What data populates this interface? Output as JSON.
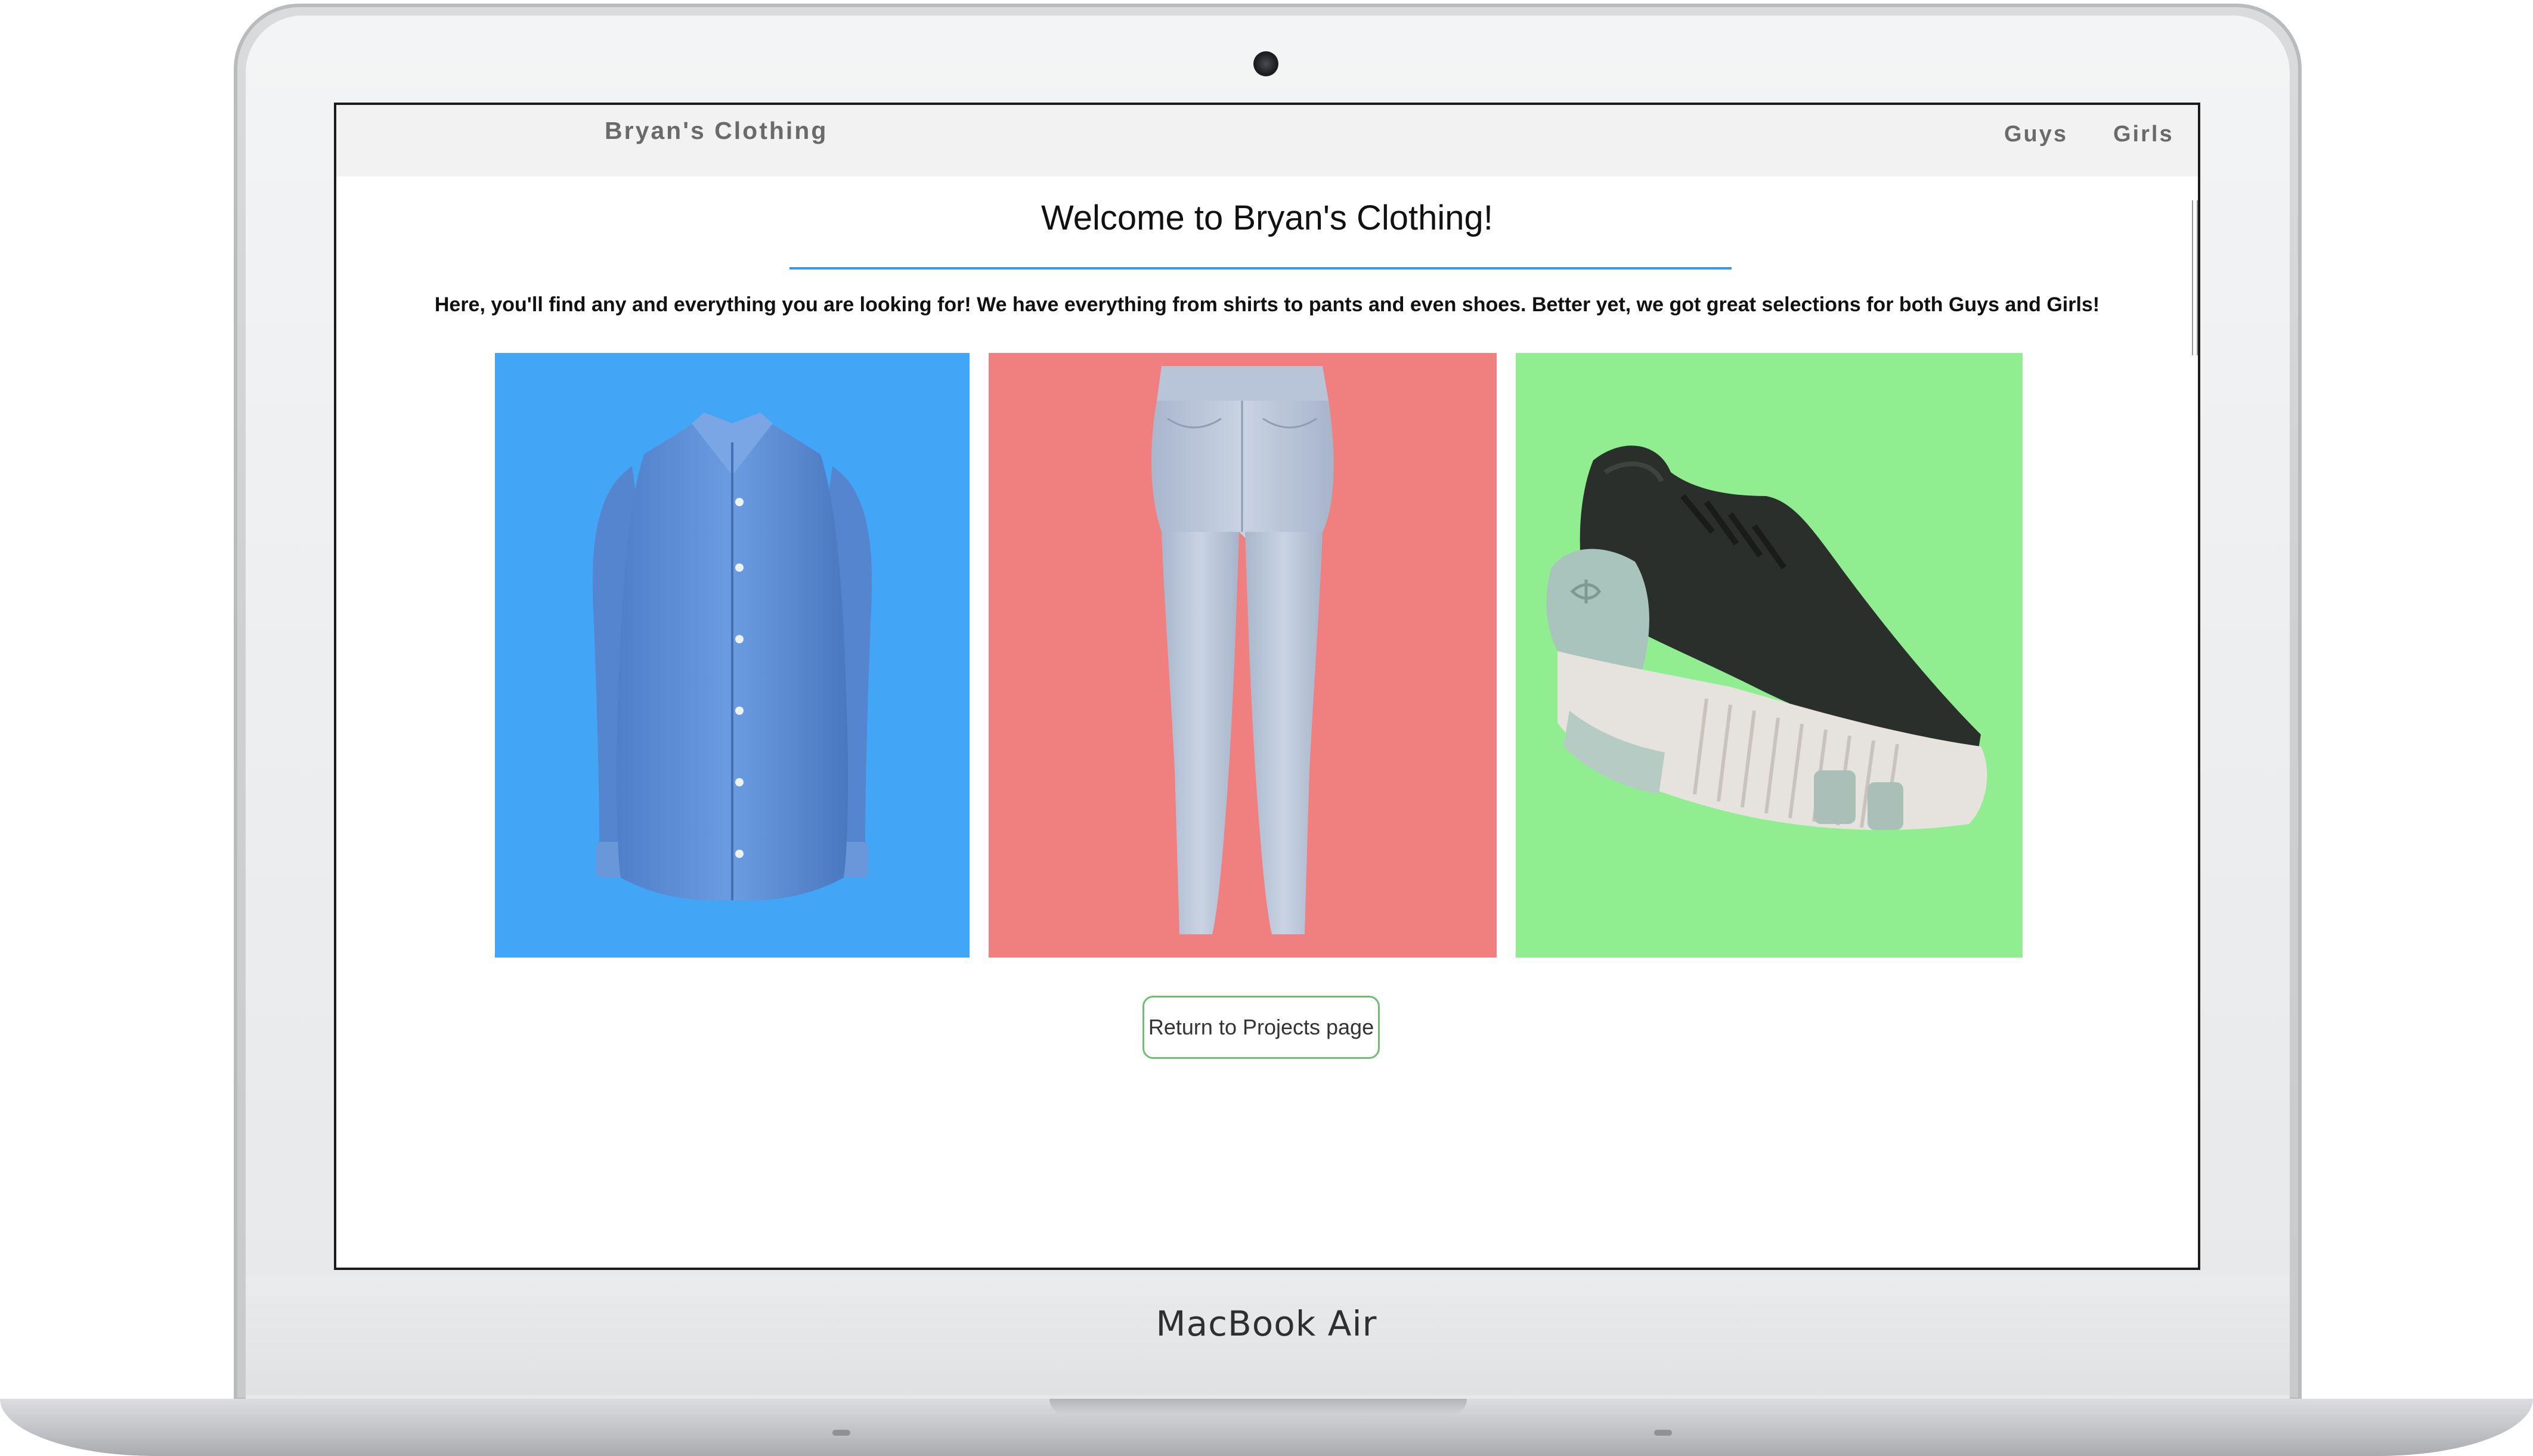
{
  "device": {
    "label": "MacBook Air"
  },
  "navbar": {
    "brand": "Bryan's Clothing",
    "links": [
      "Guys",
      "Girls"
    ]
  },
  "main": {
    "title": "Welcome to Bryan's Clothing!",
    "tagline": "Here, you'll find any and everything you are looking for! We have everything from shirts to pants and even shoes. Better yet, we got great selections for both Guys and Girls!",
    "return_button": "Return to Projects page"
  },
  "tiles": [
    {
      "item": "shirt",
      "icon": "shirt-image",
      "background": "#42a5f5"
    },
    {
      "item": "jeans",
      "icon": "jeans-image",
      "background": "#f08080"
    },
    {
      "item": "shoe",
      "icon": "sneaker-image",
      "background": "#90ee90"
    }
  ],
  "colors": {
    "divider": "#3a9ad9",
    "button_border": "#6fbf73",
    "navbar_bg": "#f2f2f2"
  }
}
